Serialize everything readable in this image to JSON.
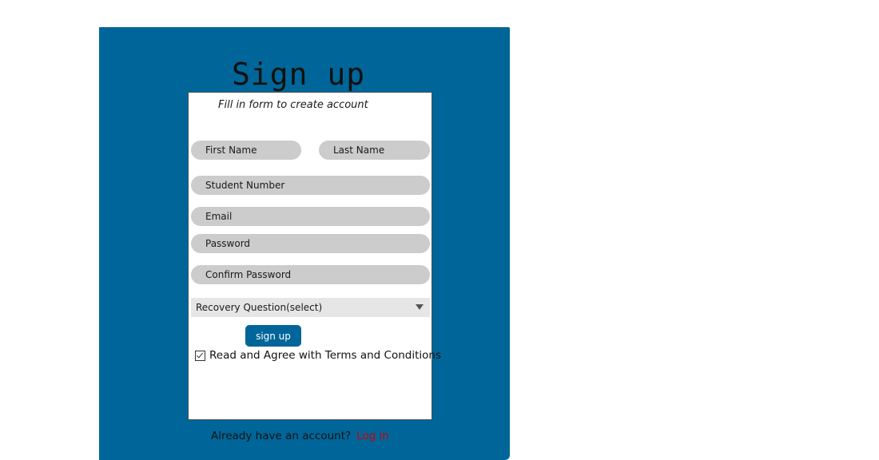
{
  "title": "Sign up",
  "subtitle": "Fill in form to create account",
  "fields": {
    "first_name": {
      "value": "",
      "placeholder": "First Name"
    },
    "last_name": {
      "value": "",
      "placeholder": "Last Name"
    },
    "student_number": {
      "value": "",
      "placeholder": "Student Number"
    },
    "email": {
      "value": "",
      "placeholder": "Email"
    },
    "password": {
      "value": "",
      "placeholder": "Password"
    },
    "confirm_password": {
      "value": "",
      "placeholder": "Confirm Password"
    }
  },
  "recovery_select": {
    "selected": "Recovery Question(select)",
    "icon": "chevron-down-icon"
  },
  "signup_button": "sign up",
  "terms": {
    "checked": true,
    "label": "Read and Agree with Terms and Conditions",
    "icon": "check-icon"
  },
  "footer": {
    "prompt": "Already have an account?",
    "login_link": "Log in",
    "login_color": "#cc0000"
  },
  "colors": {
    "accent": "#006699",
    "field_bg": "#cccccc",
    "select_bg": "#e6e6e6",
    "background": "#ffffff"
  }
}
